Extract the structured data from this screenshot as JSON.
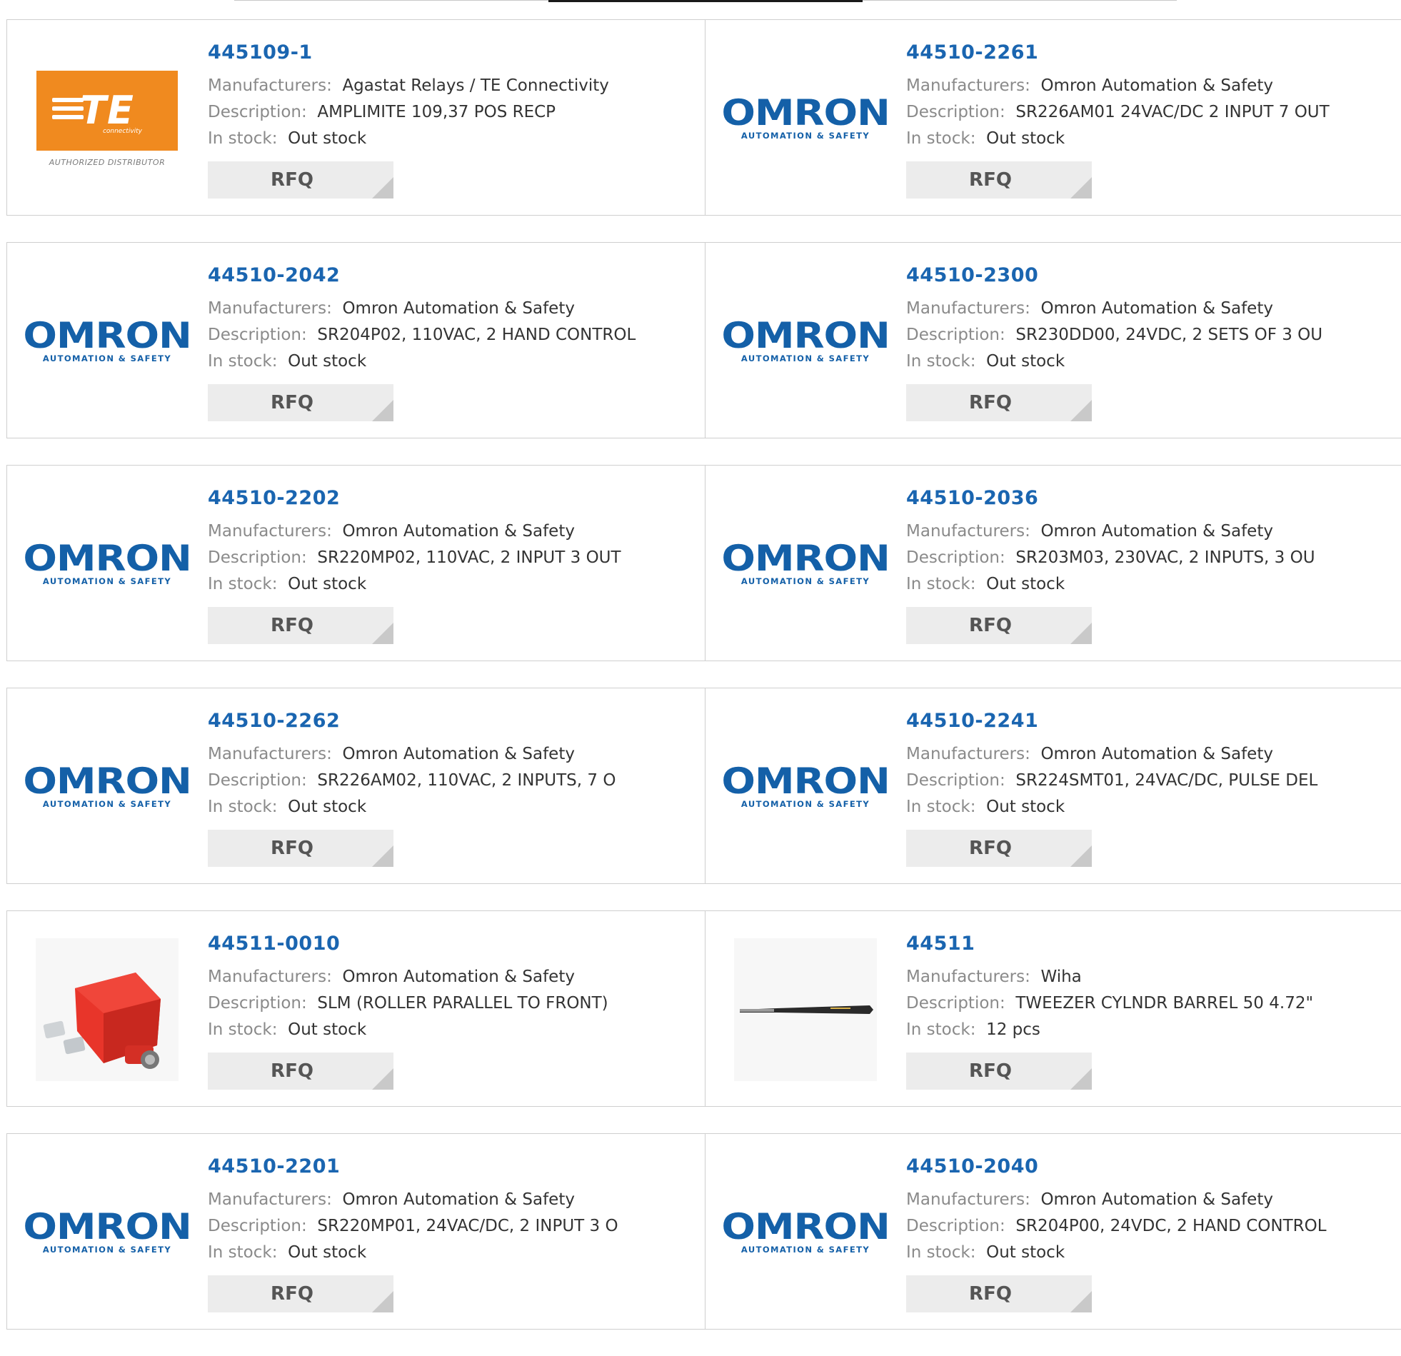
{
  "labels": {
    "manufacturers": "Manufacturers:",
    "description": "Description:",
    "in_stock": "In stock:",
    "rfq": "RFQ"
  },
  "logos": {
    "te_word": "TE",
    "te_sub": "connectivity",
    "te_caption": "AUTHORIZED DISTRIBUTOR",
    "omron_word": "OMRON",
    "omron_sub": "AUTOMATION & SAFETY"
  },
  "colors": {
    "link": "#1a65b0",
    "te_orange": "#f08a1f",
    "omron_blue": "#1460a8"
  },
  "products": [
    {
      "part": "445109-1",
      "logo": "te-logo",
      "manufacturer": "Agastat Relays / TE Connectivity",
      "description": "AMPLIMITE 109,37 POS RECP",
      "stock": "Out stock"
    },
    {
      "part": "44510-2261",
      "logo": "omron-logo",
      "manufacturer": "Omron Automation & Safety",
      "description": "SR226AM01 24VAC/DC 2 INPUT 7 OUT",
      "stock": "Out stock"
    },
    {
      "part": "44510-2042",
      "logo": "omron-logo",
      "manufacturer": "Omron Automation & Safety",
      "description": "SR204P02, 110VAC, 2 HAND CONTROL",
      "stock": "Out stock"
    },
    {
      "part": "44510-2300",
      "logo": "omron-logo",
      "manufacturer": "Omron Automation & Safety",
      "description": "SR230DD00, 24VDC, 2 SETS OF 3 OU",
      "stock": "Out stock"
    },
    {
      "part": "44510-2202",
      "logo": "omron-logo",
      "manufacturer": "Omron Automation & Safety",
      "description": "SR220MP02, 110VAC, 2 INPUT 3 OUT",
      "stock": "Out stock"
    },
    {
      "part": "44510-2036",
      "logo": "omron-logo",
      "manufacturer": "Omron Automation & Safety",
      "description": "SR203M03, 230VAC, 2 INPUTS, 3 OU",
      "stock": "Out stock"
    },
    {
      "part": "44510-2262",
      "logo": "omron-logo",
      "manufacturer": "Omron Automation & Safety",
      "description": "SR226AM02, 110VAC, 2 INPUTS, 7 O",
      "stock": "Out stock"
    },
    {
      "part": "44510-2241",
      "logo": "omron-logo",
      "manufacturer": "Omron Automation & Safety",
      "description": "SR224SMT01, 24VAC/DC, PULSE DEL",
      "stock": "Out stock"
    },
    {
      "part": "44511-0010",
      "logo": "switch-photo",
      "manufacturer": "Omron Automation & Safety",
      "description": "SLM (ROLLER PARALLEL TO FRONT)",
      "stock": "Out stock"
    },
    {
      "part": "44511",
      "logo": "tweezer-photo",
      "manufacturer": "Wiha",
      "description": "TWEEZER CYLNDR BARREL 50 4.72\"",
      "stock": "12 pcs"
    },
    {
      "part": "44510-2201",
      "logo": "omron-logo",
      "manufacturer": "Omron Automation & Safety",
      "description": "SR220MP01, 24VAC/DC, 2 INPUT 3 O",
      "stock": "Out stock"
    },
    {
      "part": "44510-2040",
      "logo": "omron-logo",
      "manufacturer": "Omron Automation & Safety",
      "description": "SR204P00, 24VDC, 2 HAND CONTROL",
      "stock": "Out stock"
    }
  ]
}
